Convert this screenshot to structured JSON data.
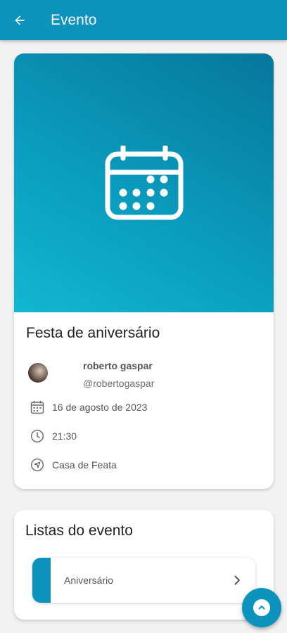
{
  "appbar": {
    "title": "Evento",
    "back_icon": "arrow-left-icon",
    "color": "#0b92bd"
  },
  "event": {
    "hero_icon": "calendar-icon",
    "title": "Festa de aniversário",
    "organizer": {
      "name": "roberto gaspar",
      "handle": "@robertogaspar"
    },
    "date": "16 de agosto de 2023",
    "date_icon": "calendar-small-icon",
    "time": "21:30",
    "time_icon": "clock-icon",
    "location": "Casa de Feata",
    "location_icon": "navigation-icon"
  },
  "lists": {
    "title": "Listas do evento",
    "items": [
      {
        "label": "Aniversário",
        "icon": "chevron-right-icon"
      }
    ]
  },
  "fab": {
    "icon": "chevron-up-icon"
  }
}
